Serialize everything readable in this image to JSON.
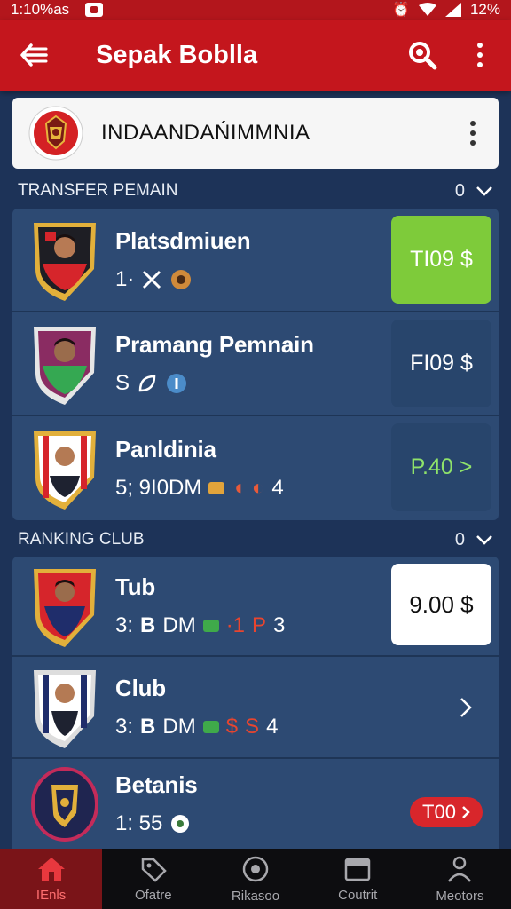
{
  "status_bar": {
    "time": "1:10%as",
    "battery": "12%"
  },
  "app_bar": {
    "title": "Sepak Boblla"
  },
  "team_selector": {
    "name": "INDAANDAŃIMMNIA"
  },
  "transfer_section": {
    "header": "TRANSFER PEMAIN",
    "count": "0",
    "items": [
      {
        "title": "Platsdmiuen",
        "subtitle": "1·",
        "price": "TI09 $",
        "price_style": "green"
      },
      {
        "title": "Pramang Pemnain",
        "subtitle": "S",
        "price": "FI09 $",
        "price_style": "dark"
      },
      {
        "title": "Panldinia",
        "subtitle": "5; 9I0DM",
        "subtitle_end": "4",
        "price": "P.40 >",
        "price_style": "dark-green"
      }
    ]
  },
  "ranking_section": {
    "header": "RANKING CLUB",
    "count": "0",
    "items": [
      {
        "title": "Tub",
        "subtitle": "3:",
        "subtitle_mid": "DM",
        "subtitle_end": "3",
        "price": "9.00 $",
        "price_style": "white"
      },
      {
        "title": "Club",
        "subtitle": "3:",
        "subtitle_mid": "DM",
        "subtitle_end": "4",
        "action": "chevron"
      },
      {
        "title": "Betanis",
        "subtitle": "1: 55",
        "pill": "T00"
      }
    ]
  },
  "bottom_nav": {
    "items": [
      {
        "label": "IEnls",
        "icon": "home-icon",
        "active": true
      },
      {
        "label": "Ofatre",
        "icon": "tag-icon",
        "active": false
      },
      {
        "label": "Rikasoo",
        "icon": "record-icon",
        "active": false
      },
      {
        "label": "Coutrit",
        "icon": "calendar-icon",
        "active": false
      },
      {
        "label": "Meotors",
        "icon": "person-icon",
        "active": false
      }
    ]
  },
  "colors": {
    "primary_red": "#c4161d",
    "background": "#1d3358",
    "card": "#2d4a73",
    "accent_green": "#7ecb3a"
  }
}
